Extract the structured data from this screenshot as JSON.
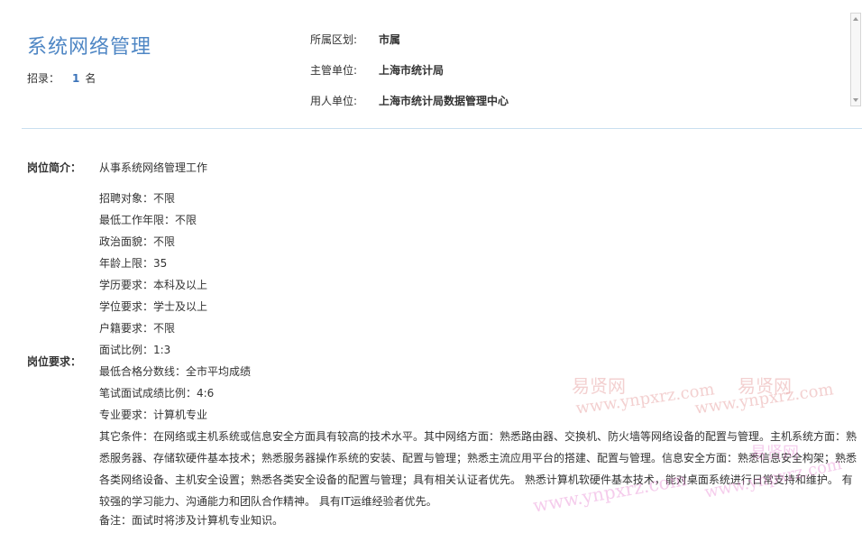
{
  "header": {
    "job_title": "系统网络管理",
    "quota_label": "招录：",
    "quota_count": "1",
    "quota_unit": "名",
    "info": [
      {
        "label": "所属区划:",
        "value": "市属"
      },
      {
        "label": "主管单位:",
        "value": "上海市统计局"
      },
      {
        "label": "用人单位:",
        "value": "上海市统计局数据管理中心"
      }
    ]
  },
  "intro": {
    "label": "岗位简介：",
    "text": "从事系统网络管理工作"
  },
  "requirements": {
    "label": "岗位要求：",
    "items": [
      "招聘对象：不限",
      "最低工作年限：不限",
      "政治面貌：不限",
      "年龄上限：35",
      "学历要求：本科及以上",
      "学位要求：学士及以上",
      "户籍要求：不限",
      "面试比例：1:3",
      "最低合格分数线：全市平均成绩",
      "笔试面试成绩比例：4:6",
      "专业要求：计算机专业"
    ],
    "other": "其它条件：在网络或主机系统或信息安全方面具有较高的技术水平。其中网络方面：熟悉路由器、交换机、防火墙等网络设备的配置与管理。主机系统方面：熟悉服务器、存储软硬件基本技术；熟悉服务器操作系统的安装、配置与管理；熟悉主流应用平台的搭建、配置与管理。信息安全方面：熟悉信息安全构架；熟悉各类网络设备、主机安全设置；熟悉各类安全设备的配置与管理；具有相关认证者优先。 熟悉计算机软硬件基本技术，能对桌面系统进行日常支持和维护。 有较强的学习能力、沟通能力和团队合作精神。 具有IT运维经验者优先。",
    "note": "备注：面试时将涉及计算机专业知识。"
  },
  "watermarks": {
    "brand": "易贤网",
    "url": "www.ynpxrz.com"
  }
}
